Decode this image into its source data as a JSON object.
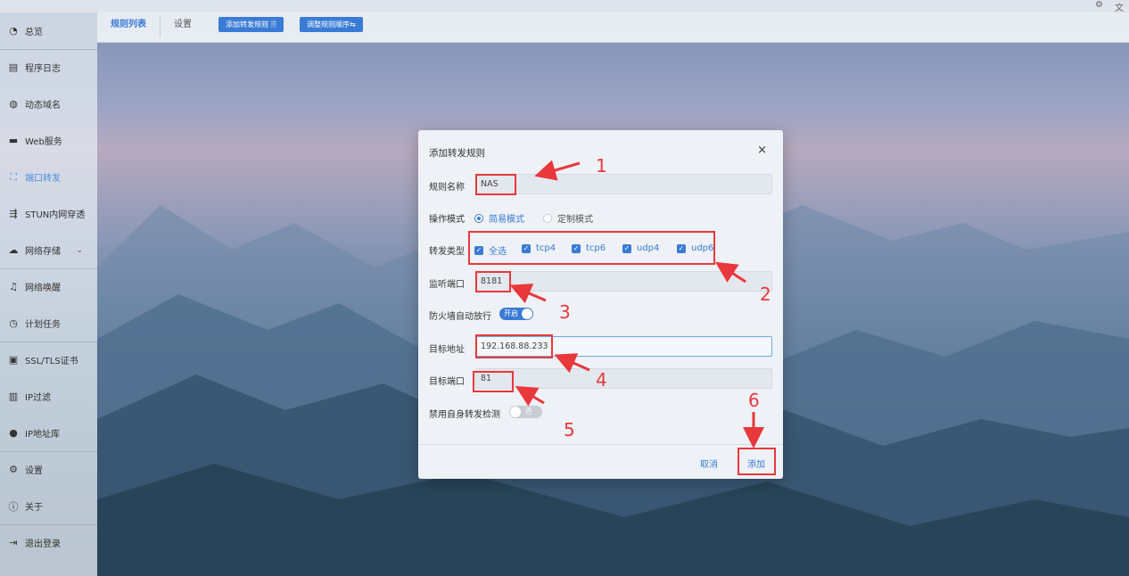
{
  "colors": {
    "accent": "#3a7bd5",
    "annotation": "#e8383b"
  },
  "topbar": {
    "icons": [
      "gear-icon",
      "translate-icon"
    ]
  },
  "sidebar": {
    "items": [
      {
        "label": "总览",
        "icon": "dashboard-icon"
      },
      {
        "label": "程序日志",
        "icon": "log-icon"
      },
      {
        "label": "动态域名",
        "icon": "globe-icon"
      },
      {
        "label": "Web服务",
        "icon": "web-icon"
      },
      {
        "label": "端口转发",
        "icon": "port-forward-icon",
        "active": true
      },
      {
        "label": "STUN内网穿透",
        "icon": "stun-icon"
      },
      {
        "label": "网络存储",
        "icon": "cloud-icon",
        "has_submenu": true
      },
      {
        "label": "网络唤醒",
        "icon": "bell-icon"
      },
      {
        "label": "计划任务",
        "icon": "clock-icon"
      },
      {
        "label": "SSL/TLS证书",
        "icon": "certificate-icon"
      },
      {
        "label": "IP过滤",
        "icon": "filter-icon"
      },
      {
        "label": "IP地址库",
        "icon": "user-icon"
      },
      {
        "label": "设置",
        "icon": "settings-icon"
      },
      {
        "label": "关于",
        "icon": "info-icon"
      },
      {
        "label": "退出登录",
        "icon": "logout-icon"
      }
    ]
  },
  "tabs": [
    {
      "label": "规则列表",
      "active": true
    },
    {
      "label": "设置",
      "active": false
    }
  ],
  "toolbar": {
    "add_rule_label": "添加转发规则 🗎",
    "reorder_label": "调整规则顺序⇆"
  },
  "dialog": {
    "title": "添加转发规则",
    "close_icon": "×",
    "rule_name": {
      "label": "规则名称",
      "value": "NAS"
    },
    "mode": {
      "label": "操作模式",
      "options": [
        "简易模式",
        "定制模式"
      ],
      "selected": "简易模式"
    },
    "forward_type": {
      "label": "转发类型",
      "options": [
        "全选",
        "tcp4",
        "tcp6",
        "udp4",
        "udp6"
      ],
      "checked": [
        "全选",
        "tcp4",
        "tcp6",
        "udp4",
        "udp6"
      ]
    },
    "listen_port": {
      "label": "监听端口",
      "value": "8181"
    },
    "firewall": {
      "label": "防火墙自动放行",
      "state_text": "开启",
      "on": true
    },
    "target_address": {
      "label": "目标地址",
      "value": "192.168.88.233"
    },
    "target_port": {
      "label": "目标端口",
      "value": "81"
    },
    "disable_self_check": {
      "label": "禁用自身转发检测",
      "state_text": "否",
      "on": false
    },
    "cancel_label": "取消",
    "add_label": "添加"
  },
  "annotations": [
    "1",
    "2",
    "3",
    "4",
    "5",
    "6"
  ]
}
